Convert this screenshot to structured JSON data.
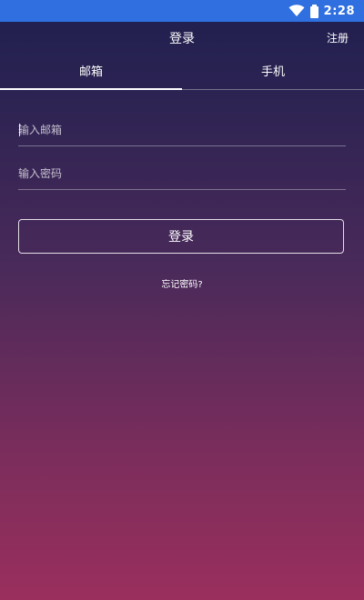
{
  "status_bar": {
    "time": "2:28",
    "color": "#2f6fe0",
    "icons": [
      "wifi-icon",
      "battery-icon"
    ]
  },
  "header": {
    "title": "登录",
    "register_label": "注册"
  },
  "tabs": [
    {
      "label": "邮箱",
      "active": true
    },
    {
      "label": "手机",
      "active": false
    }
  ],
  "form": {
    "email_placeholder": "输入邮箱",
    "email_value": "",
    "password_placeholder": "输入密码",
    "password_value": "",
    "login_label": "登录",
    "forgot_label": "忘记密码?"
  },
  "colors": {
    "gradient_top": "#1f1f4f",
    "gradient_bottom": "#9a2f5d",
    "text": "#ffffff"
  }
}
